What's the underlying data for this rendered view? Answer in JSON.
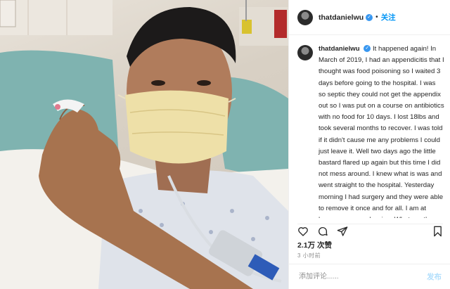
{
  "header": {
    "username": "thatdanielwu",
    "dot": "•",
    "follow_label": "关注"
  },
  "caption": {
    "username": "thatdanielwu",
    "text": "It happened again! In March of 2019, I had an appendicitis that I thought was food poisoning so I waited 3 days before going to the hospital. I was so septic they could not get the appendix out so I was put on a course on antibiotics with no food for 10 days. I lost 18lbs and took several months to recover. I was told if it didn't cause me any problems I could just leave it. Well two days ago the little bastard flared up again but this time I did not mess around. I knew what is was and went straight to the hospital. Yesterday morning I had surgery and they were able to remove it once and for all. I am at home now convalescing. What are the chances of having two appendicitis' ?!?! I think I should buy a lottery ticket today!"
  },
  "engagement": {
    "likes": "2.1万 次赞",
    "time": "3 小时前"
  },
  "comment_box": {
    "placeholder": "添加评论......",
    "post_label": "发布"
  },
  "icons": [
    "verified-badge-icon",
    "heart-icon",
    "comment-icon",
    "share-icon",
    "bookmark-icon"
  ],
  "colors": {
    "link": "#0095f6",
    "verified": "#3897f0",
    "post_disabled": "#b2dffc",
    "text": "#262626",
    "muted": "#8e8e8e"
  }
}
